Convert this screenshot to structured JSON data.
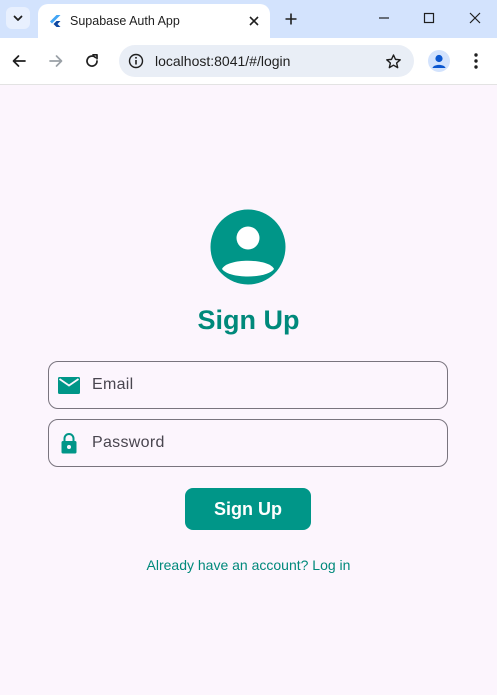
{
  "browser": {
    "tab_title": "Supabase Auth App",
    "url": "localhost:8041/#/login"
  },
  "page": {
    "heading": "Sign Up",
    "email": {
      "placeholder": "Email",
      "value": ""
    },
    "password": {
      "placeholder": "Password",
      "value": ""
    },
    "submit_label": "Sign Up",
    "login_link": "Already have an account? Log in"
  },
  "colors": {
    "accent": "#009688",
    "page_background": "#fcf5fd"
  }
}
